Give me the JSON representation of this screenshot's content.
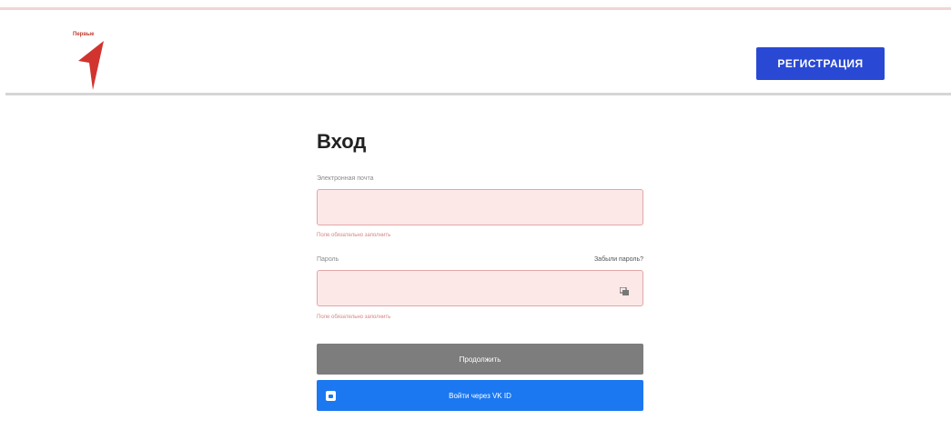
{
  "header": {
    "logo_text": "Первые",
    "register_label": "РЕГИСТРАЦИЯ"
  },
  "form": {
    "title": "Вход",
    "email_label": "Электронная почта",
    "email_value": "",
    "email_error": "Поле обязательно заполнить",
    "password_label": "Пароль",
    "forgot_label": "Забыли пароль?",
    "password_value": "",
    "password_error": "Поле обязательно заполнить",
    "continue_label": "Продолжить",
    "vk_label": "Войти через VK ID"
  },
  "colors": {
    "accent": "#2949d4",
    "vk": "#1b78f0",
    "error_bg": "#fde8e8",
    "logo": "#c0392b"
  }
}
